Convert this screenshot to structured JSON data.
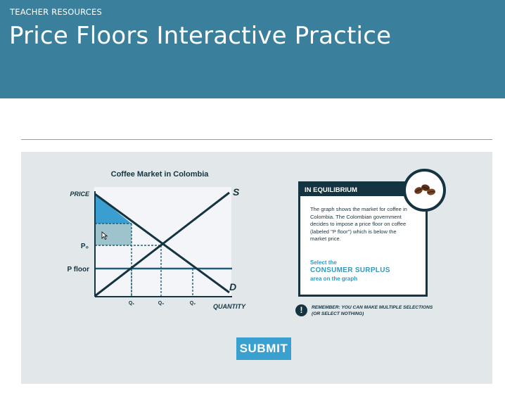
{
  "header": {
    "eyebrow": "TEACHER RESOURCES",
    "title": "Price Floors Interactive Practice"
  },
  "graph": {
    "title": "Coffee Market in Colombia",
    "y_axis_label": "PRICE",
    "x_axis_label": "QUANTITY",
    "supply_label": "S",
    "demand_label": "D",
    "p0_label": "P₀",
    "pfloor_label": "P floor",
    "q1_label": "Q₁",
    "q0_label": "Q₀",
    "q2_label": "Q₂"
  },
  "info_card": {
    "header": "IN EQUILIBRIUM",
    "body": "The graph shows the market for coffee in Colombia. The Colombian government decides to impose a price floor on coffee (labeled \"P floor\") which is below the market price.",
    "prompt_line1": "Select the",
    "prompt_emphasis": "CONSUMER SURPLUS",
    "prompt_line2": "area on the graph",
    "badge_icon": "coffee-beans-icon"
  },
  "reminder": {
    "icon": "exclamation-icon",
    "text": "Remember: You can make multiple selections (or select nothing)"
  },
  "submit_label": "SUBMIT",
  "colors": {
    "header_bg": "#3a7f9b",
    "panel_bg": "#e2e7e9",
    "navy": "#143441",
    "accent_blue": "#3aa0cf",
    "selected_area": "#3a9fd0",
    "hover_area": "#9fc3cc"
  }
}
